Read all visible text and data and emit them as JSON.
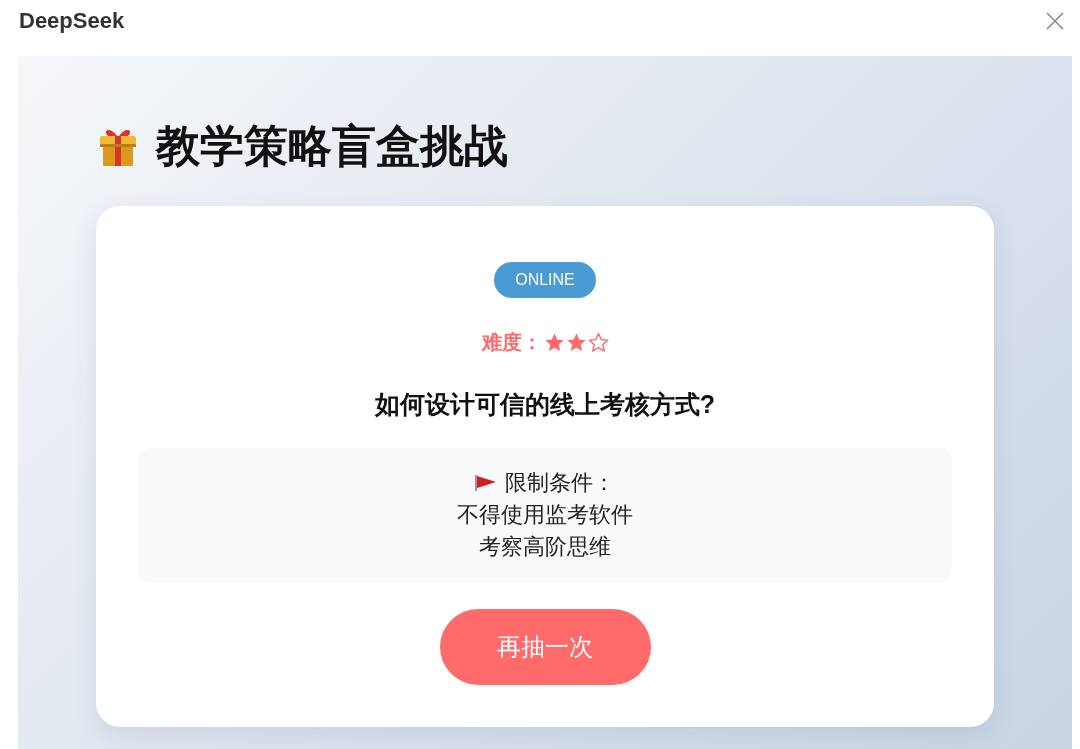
{
  "window": {
    "title": "DeepSeek"
  },
  "page": {
    "title": "教学策略盲盒挑战",
    "card": {
      "badge": "ONLINE",
      "difficulty": {
        "label": "难度：",
        "stars": 2
      },
      "question": "如何设计可信的线上考核方式?",
      "constraints": {
        "heading": "限制条件：",
        "items": [
          "不得使用监考软件",
          "考察高阶思维"
        ]
      },
      "button": "再抽一次"
    }
  }
}
